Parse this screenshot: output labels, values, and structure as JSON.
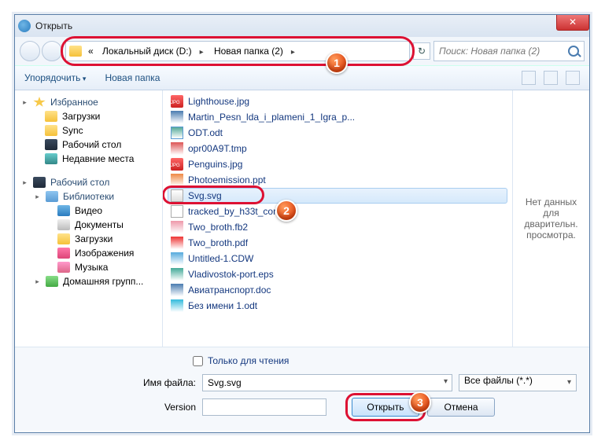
{
  "window": {
    "title": "Открыть"
  },
  "nav": {
    "prefix": "«",
    "crumbs": [
      "Локальный диск (D:)",
      "Новая папка (2)"
    ],
    "search_placeholder": "Поиск: Новая папка (2)"
  },
  "toolbar": {
    "organize": "Упорядочить",
    "newfolder": "Новая папка"
  },
  "sidebar": {
    "fav_header": "Избранное",
    "fav": [
      "Загрузки",
      "Sync",
      "Рабочий стол",
      "Недавние места"
    ],
    "desk_header": "Рабочий стол",
    "lib_header": "Библиотеки",
    "libs": [
      "Видео",
      "Документы",
      "Загрузки",
      "Изображения",
      "Музыка"
    ],
    "homegroup": "Домашняя групп..."
  },
  "files": [
    {
      "name": "Lighthouse.jpg",
      "icon": "jpg"
    },
    {
      "name": "Martin_Pesn_lda_i_plameni_1_Igra_p...",
      "icon": "docx"
    },
    {
      "name": "ODT.odt",
      "icon": "doc"
    },
    {
      "name": "opr00A9T.tmp",
      "icon": "tmp"
    },
    {
      "name": "Penguins.jpg",
      "icon": "jpg"
    },
    {
      "name": "Photoemission.ppt",
      "icon": "ppt"
    },
    {
      "name": "Svg.svg",
      "icon": "svg",
      "selected": true
    },
    {
      "name": "tracked_by_h33t_com.txt",
      "icon": "txt"
    },
    {
      "name": "Two_broth.fb2",
      "icon": "fb2"
    },
    {
      "name": "Two_broth.pdf",
      "icon": "pdf"
    },
    {
      "name": "Untitled-1.CDW",
      "icon": "cdw"
    },
    {
      "name": "Vladivostok-port.eps",
      "icon": "eps"
    },
    {
      "name": "Авиатранспорт.doc",
      "icon": "docx"
    },
    {
      "name": "Без имени 1.odt",
      "icon": "odt"
    }
  ],
  "preview": {
    "text": "Нет данных для дварительн. просмотра."
  },
  "footer": {
    "readonly": "Только для чтения",
    "filename_label": "Имя файла:",
    "filename_value": "Svg.svg",
    "filter": "Все файлы (*.*)",
    "version_label": "Version",
    "open": "Открыть",
    "cancel": "Отмена"
  },
  "bubbles": {
    "b1": "1",
    "b2": "2",
    "b3": "3"
  }
}
